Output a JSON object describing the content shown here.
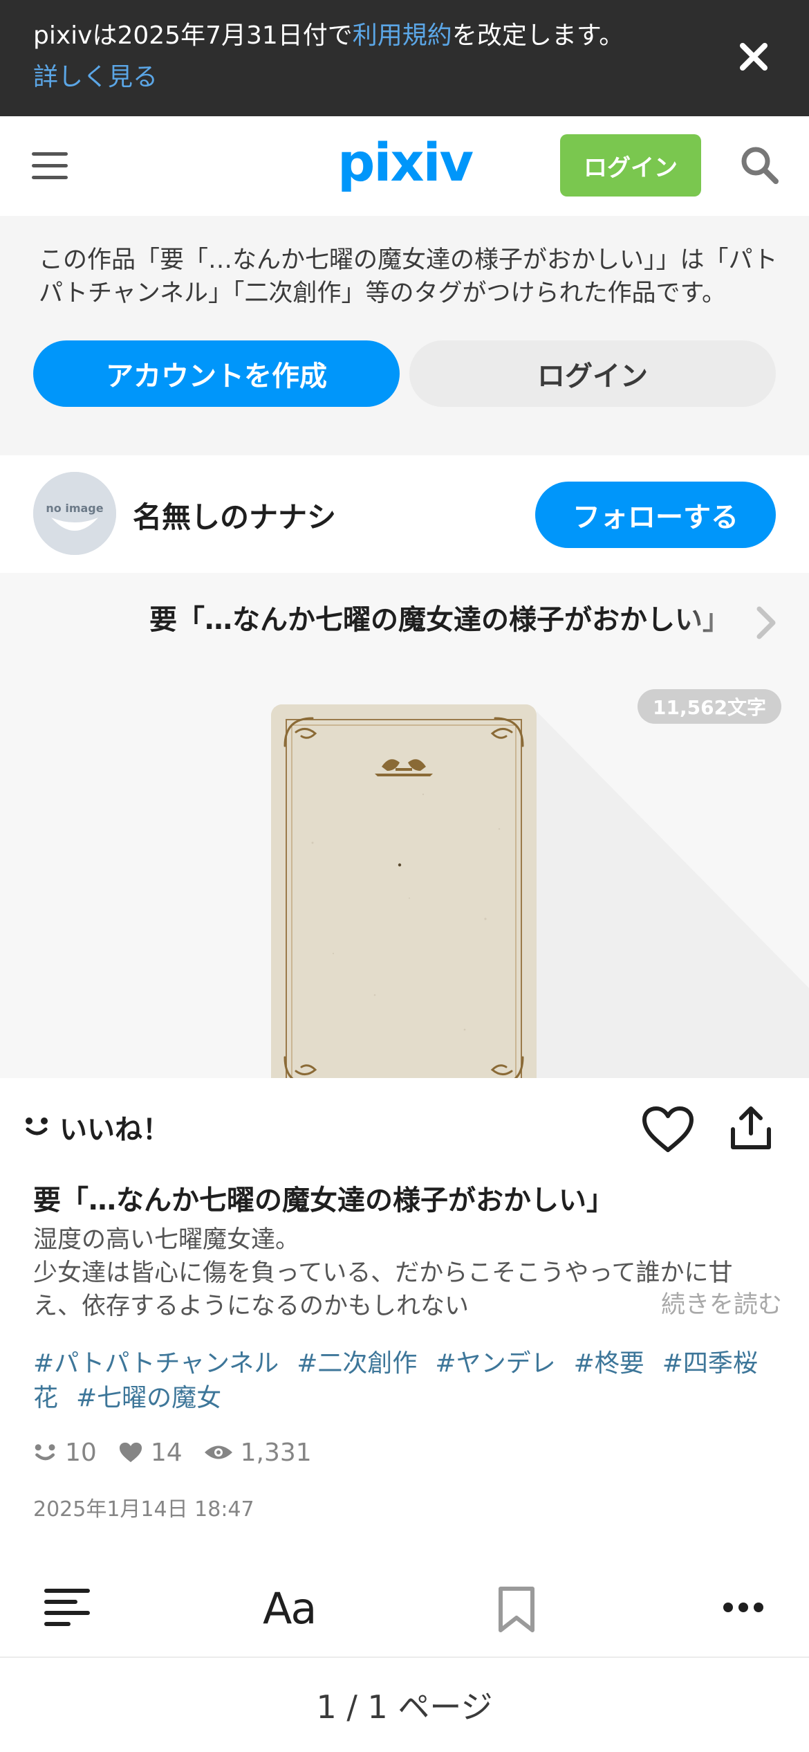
{
  "notice": {
    "text_before": "pixivは2025年7月31日付で",
    "link": "利用規約",
    "text_after": "を改定します。",
    "more": "詳しく見る"
  },
  "header": {
    "logo": "pixiv",
    "login": "ログイン"
  },
  "promo": {
    "text": "この作品「要「…なんか七曜の魔女達の様子がおかしい」」は「パトパトチャンネル」「二次創作」等のタグがつけられた作品です。",
    "create_account": "アカウントを作成",
    "login": "ログイン"
  },
  "author": {
    "avatar_text": "no image",
    "name": "名無しのナナシ",
    "follow": "フォローする"
  },
  "series": {
    "title": "要「…なんか七曜の魔女達の様子がおかしい」"
  },
  "cover": {
    "char_count": "11,562文字"
  },
  "reactions": {
    "iine": "いいね！"
  },
  "work": {
    "title": "要「…なんか七曜の魔女達の様子がおかしい」",
    "caption_line1": "湿度の高い七曜魔女達。",
    "caption_line2": "少女達は皆心に傷を負っている、だからこそこうやって誰かに甘え、依存するようになるのかもしれない",
    "read_more": "続きを読む",
    "tags": [
      "#パトパトチャンネル",
      "#二次創作",
      "#ヤンデレ",
      "#柊要",
      "#四季桜花",
      "#七曜の魔女"
    ],
    "stats": {
      "likes": "10",
      "bookmarks": "14",
      "views": "1,331"
    },
    "date": "2025年1月14日 18:47"
  },
  "toolbar": {
    "font": "Aa"
  },
  "pager": {
    "text": "1 / 1 ページ"
  },
  "colors": {
    "accent": "#0096fa",
    "login_green": "#7ac74f",
    "tag": "#3d7699",
    "notice_bg": "#2e2e2e"
  }
}
